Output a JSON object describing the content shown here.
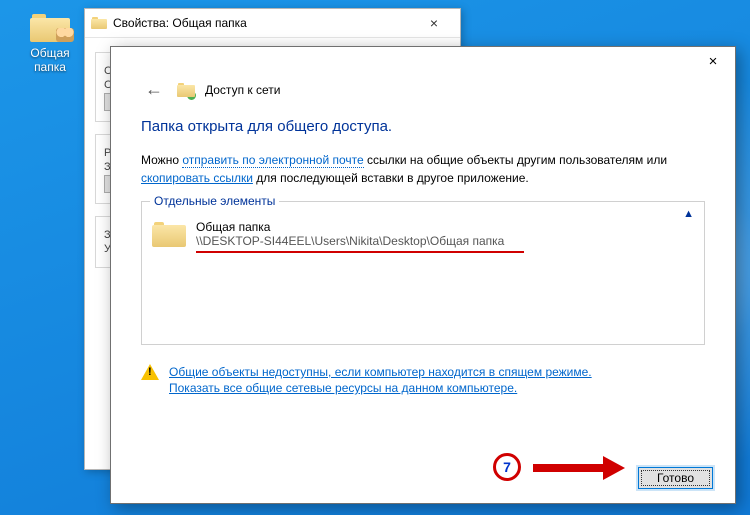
{
  "desktop": {
    "icon_label": "Общая папка"
  },
  "properties_window": {
    "title": "Свойства: Общая папка"
  },
  "wizard": {
    "header_title": "Доступ к сети",
    "headline": "Папка открыта для общего доступа.",
    "body_prefix": "Можно ",
    "body_link1": "отправить по электронной почте",
    "body_mid": " ссылки на общие объекты другим пользователям или ",
    "body_link2": "скопировать ссылки",
    "body_suffix": " для последующей вставки в другое приложение.",
    "group_legend": "Отдельные элементы",
    "collapse_glyph": "▲",
    "item": {
      "name": "Общая папка",
      "path": "\\\\DESKTOP-SI44EEL\\Users\\Nikita\\Desktop\\Общая папка"
    },
    "warn_link": "Общие объекты недоступны, если компьютер находится в спящем режиме.",
    "show_all_link": "Показать все общие сетевые ресурсы на данном компьютере.",
    "done_label": "Готово"
  },
  "annotation": {
    "step": "7"
  }
}
